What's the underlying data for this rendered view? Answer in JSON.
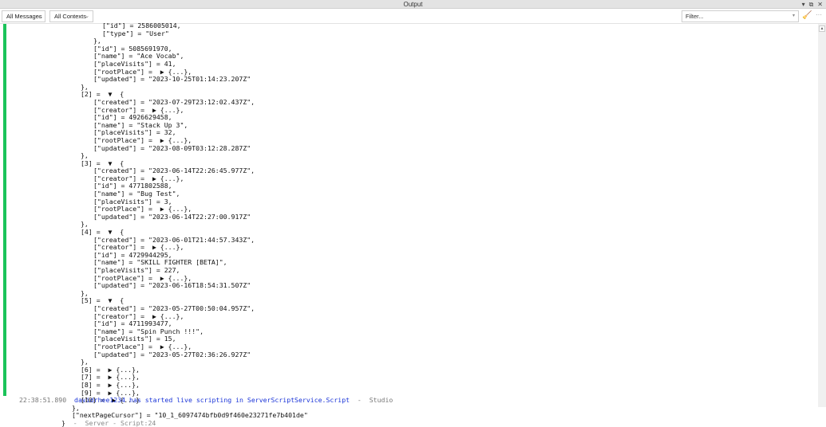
{
  "title": "Output",
  "window_controls": [
    "▾",
    "⧉",
    "✕"
  ],
  "toolbar": {
    "messages_filter": "All Messages",
    "contexts_filter": "All Contexts",
    "filter_placeholder": "Filter...",
    "clear_icon": "broom-icon",
    "more": "···"
  },
  "lines": [
    {
      "indent": 4,
      "text": "[\"id\"] = 2586005014,"
    },
    {
      "indent": 4,
      "text": "[\"type\"] = \"User\""
    },
    {
      "indent": 3,
      "text": "},"
    },
    {
      "indent": 3,
      "text": "[\"id\"] = 5085691970,"
    },
    {
      "indent": 3,
      "text": "[\"name\"] = \"Ace Vocab\","
    },
    {
      "indent": 3,
      "text": "[\"placeVisits\"] = 41,"
    },
    {
      "indent": 3,
      "text": "[\"rootPlace\"] =  ▶ {...},"
    },
    {
      "indent": 3,
      "text": "[\"updated\"] = \"2023-10-25T01:14:23.207Z\""
    },
    {
      "indent": 2,
      "text": "},"
    },
    {
      "indent": 2,
      "text": "[2] =  ▼  {"
    },
    {
      "indent": 3,
      "text": "[\"created\"] = \"2023-07-29T23:12:02.437Z\","
    },
    {
      "indent": 3,
      "text": "[\"creator\"] =  ▶ {...},"
    },
    {
      "indent": 3,
      "text": "[\"id\"] = 4926629458,"
    },
    {
      "indent": 3,
      "text": "[\"name\"] = \"Stack Up 3\","
    },
    {
      "indent": 3,
      "text": "[\"placeVisits\"] = 32,"
    },
    {
      "indent": 3,
      "text": "[\"rootPlace\"] =  ▶ {...},"
    },
    {
      "indent": 3,
      "text": "[\"updated\"] = \"2023-08-09T03:12:28.287Z\""
    },
    {
      "indent": 2,
      "text": "},"
    },
    {
      "indent": 2,
      "text": "[3] =  ▼  {"
    },
    {
      "indent": 3,
      "text": "[\"created\"] = \"2023-06-14T22:26:45.977Z\","
    },
    {
      "indent": 3,
      "text": "[\"creator\"] =  ▶ {...},"
    },
    {
      "indent": 3,
      "text": "[\"id\"] = 4771802588,"
    },
    {
      "indent": 3,
      "text": "[\"name\"] = \"Bug Test\","
    },
    {
      "indent": 3,
      "text": "[\"placeVisits\"] = 3,"
    },
    {
      "indent": 3,
      "text": "[\"rootPlace\"] =  ▶ {...},"
    },
    {
      "indent": 3,
      "text": "[\"updated\"] = \"2023-06-14T22:27:00.917Z\""
    },
    {
      "indent": 2,
      "text": "},"
    },
    {
      "indent": 2,
      "text": "[4] =  ▼  {"
    },
    {
      "indent": 3,
      "text": "[\"created\"] = \"2023-06-01T21:44:57.343Z\","
    },
    {
      "indent": 3,
      "text": "[\"creator\"] =  ▶ {...},"
    },
    {
      "indent": 3,
      "text": "[\"id\"] = 4729944295,"
    },
    {
      "indent": 3,
      "text": "[\"name\"] = \"SKILL FIGHTER [BETA]\","
    },
    {
      "indent": 3,
      "text": "[\"placeVisits\"] = 227,"
    },
    {
      "indent": 3,
      "text": "[\"rootPlace\"] =  ▶ {...},"
    },
    {
      "indent": 3,
      "text": "[\"updated\"] = \"2023-06-16T18:54:31.507Z\""
    },
    {
      "indent": 2,
      "text": "},"
    },
    {
      "indent": 2,
      "text": "[5] =  ▼  {"
    },
    {
      "indent": 3,
      "text": "[\"created\"] = \"2023-05-27T00:50:04.957Z\","
    },
    {
      "indent": 3,
      "text": "[\"creator\"] =  ▶ {...},"
    },
    {
      "indent": 3,
      "text": "[\"id\"] = 4711993477,"
    },
    {
      "indent": 3,
      "text": "[\"name\"] = \"Spin Punch !!!\","
    },
    {
      "indent": 3,
      "text": "[\"placeVisits\"] = 15,"
    },
    {
      "indent": 3,
      "text": "[\"rootPlace\"] =  ▶ {...},"
    },
    {
      "indent": 3,
      "text": "[\"updated\"] = \"2023-05-27T02:36:26.927Z\""
    },
    {
      "indent": 2,
      "text": "},"
    },
    {
      "indent": 2,
      "text": "[6] =  ▶ {...},"
    },
    {
      "indent": 2,
      "text": "[7] =  ▶ {...},"
    },
    {
      "indent": 2,
      "text": "[8] =  ▶ {...},"
    },
    {
      "indent": 2,
      "text": "[9] =  ▶ {...},"
    },
    {
      "indent": 2,
      "text": "[10] =  ▶ {...}"
    },
    {
      "indent": 1,
      "text": "},"
    },
    {
      "indent": 1,
      "text": "[\"nextPageCursor\"] = \"10_1_6097474bfb0d9f460e23271fe7b401de\""
    },
    {
      "indent": 0,
      "text": "}",
      "meta": "  -  Server - Script:24"
    }
  ],
  "log": {
    "time": "22:38:51.890",
    "message": "davidrhee1234 has started live scripting in ServerScriptService.Script",
    "source": "  -  Studio"
  }
}
